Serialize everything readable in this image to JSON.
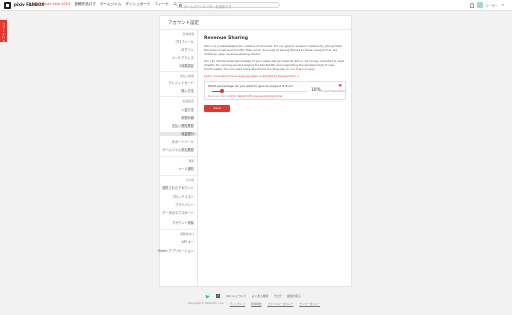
{
  "topbar": {
    "brand": "pixiv FANBOX",
    "nav": [
      "Summer Sale 2024",
      "投稿作品ログ",
      "ゲームジャム",
      "ダッシュボード",
      "フィード",
      "コミュニティ"
    ],
    "search_placeholder": "ゲームやクリエイターを検索する",
    "user_name": "ユーザー",
    "colors": {
      "accent": "#e3372e",
      "avatar": "#9ed8d8"
    }
  },
  "feedback_tab": "フィードバック",
  "card": {
    "title": "アカウント設定"
  },
  "sidebar": {
    "sections": [
      {
        "label": "基本情報",
        "items": [
          "プロフィール",
          "ログイン",
          "メールアドレス",
          "2段階認証"
        ]
      },
      {
        "label": "支払い情報",
        "items": [
          "クレジットカード",
          "購入方法"
        ]
      },
      {
        "label": "収益設定",
        "items": [
          "入金方法",
          "税務情報",
          "支払い履歴履歴",
          "収益配分"
        ]
      },
      {
        "label": "通知",
        "items": [
          "メール通知"
        ]
      },
      {
        "label": "その他",
        "items": [
          "連携されたアカウント",
          "ブロックリスト",
          "プライバシー",
          "データのエクスポート",
          "アカウント削除"
        ]
      },
      {
        "label": "開発者向け",
        "items": [
          "API キー",
          "OAuth アプリケーション"
        ]
      }
    ],
    "items_extra": [
      "サポートツール",
      "ゲームジャム参加履歴"
    ]
  },
  "main": {
    "title": "Revenue Sharing",
    "para1": "itch.io is a marketplace for creators of all kinds. It's our goal to support creators by giving them the tools to sell and monitor their work. As a way of saving thanks to those using itch.io, we utilize an open revenue sharing model.",
    "para2_a": "You can decide what percentage of your sales will go towards itch.io. All money collected is used directly for running servers paying for bandwidth and supporting the development of new functionality. You can read more about itch.io's finances on our ",
    "para2_link": "finance page",
    "learn_link": "Learn more about how revenue share is applied to transactions →",
    "support": {
      "question": "What percentage do you want to give to support itch.io?",
      "percent": "10%",
      "percent_label": "of each transaction",
      "percent_value": 10,
      "note_a": "Revenue sharing ",
      "note_link": "Itch's default 10% revenue sharing model"
    },
    "save_label": "Save"
  },
  "footer": {
    "links": [
      "itch.io について",
      "よくある質問",
      "ブログ",
      "連絡を取る"
    ],
    "copyright": "Copyright © 2024 itch corp",
    "bottom_links": [
      "ディレクトリ",
      "利用規約",
      "プライバシーポリシー",
      "クッキーポリシー"
    ]
  }
}
